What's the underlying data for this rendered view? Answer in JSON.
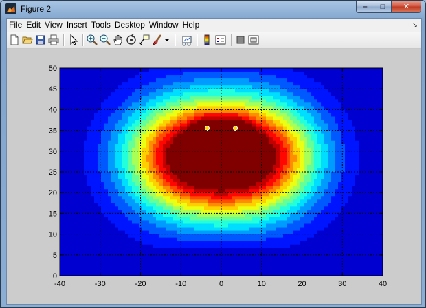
{
  "window": {
    "title": "Figure 2",
    "min_glyph": "–",
    "max_glyph": "□",
    "close_glyph": "✕"
  },
  "menu": {
    "items": [
      "File",
      "Edit",
      "View",
      "Insert",
      "Tools",
      "Desktop",
      "Window",
      "Help"
    ],
    "dock_glyph": "↘"
  },
  "toolbar": {
    "icons": [
      "new-figure-icon",
      "open-file-icon",
      "save-icon",
      "print-icon",
      "pointer-icon",
      "zoom-in-icon",
      "zoom-out-icon",
      "pan-icon",
      "rotate-3d-icon",
      "data-cursor-icon",
      "brush-icon",
      "brush-dropdown-icon",
      "link-plot-icon",
      "colorbar-icon",
      "legend-icon",
      "hide-plot-tools-icon",
      "show-plot-tools-icon"
    ]
  },
  "chart_data": {
    "type": "heatmap",
    "style": "filled-contour",
    "colormap": "jet",
    "xlim": [
      -40,
      40
    ],
    "ylim": [
      0,
      50
    ],
    "xticks": [
      -40,
      -30,
      -20,
      -10,
      0,
      10,
      20,
      30,
      40
    ],
    "yticks": [
      0,
      5,
      10,
      15,
      20,
      25,
      30,
      35,
      40,
      45,
      50
    ],
    "grid": true,
    "grid_style": "dashed",
    "title": "",
    "xlabel": "",
    "ylabel": "",
    "levels": 15,
    "background_color": "#cccccc",
    "sources": [
      {
        "x": -3.5,
        "y": 35.5
      },
      {
        "x": 3.5,
        "y": 35.5
      }
    ],
    "peaks": [
      {
        "x": -10,
        "y": 29
      },
      {
        "x": 10,
        "y": 29
      }
    ]
  }
}
